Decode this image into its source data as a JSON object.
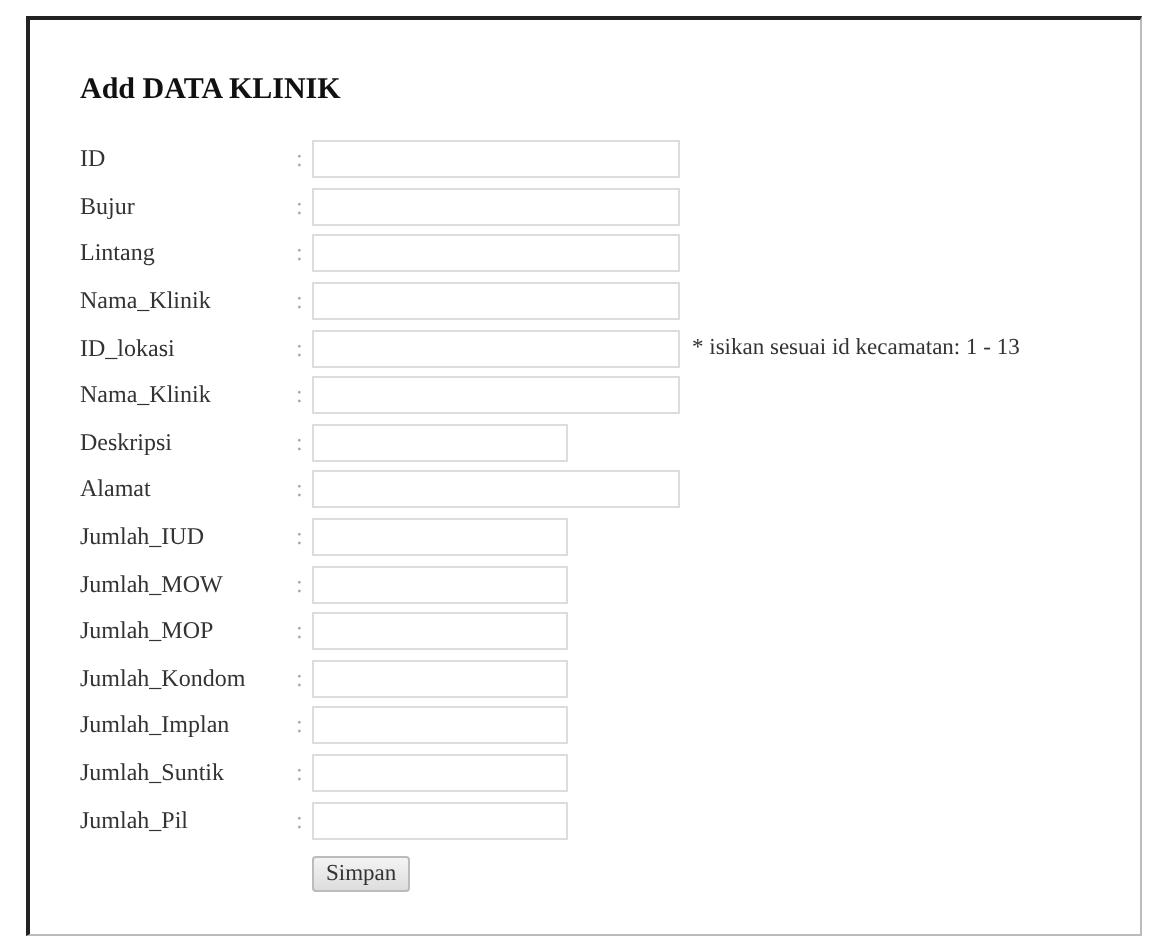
{
  "title": "Add DATA KLINIK",
  "fields": [
    {
      "label": "ID",
      "separator": ":",
      "kind": "long"
    },
    {
      "label": "Bujur",
      "separator": ":",
      "kind": "long"
    },
    {
      "label": "Lintang",
      "separator": ":",
      "kind": "long"
    },
    {
      "label": "Nama_Klinik",
      "separator": ":",
      "kind": "long"
    },
    {
      "label": "ID_lokasi",
      "separator": ":",
      "kind": "long",
      "note": "* isikan sesuai id kecamatan: 1 - 13"
    },
    {
      "label": "Nama_Klinik",
      "separator": ":",
      "kind": "long"
    },
    {
      "label": "Deskripsi",
      "separator": ":",
      "kind": "short"
    },
    {
      "label": "Alamat",
      "separator": ":",
      "kind": "long"
    },
    {
      "label": "Jumlah_IUD",
      "separator": ":",
      "kind": "short"
    },
    {
      "label": "Jumlah_MOW",
      "separator": ":",
      "kind": "short"
    },
    {
      "label": "Jumlah_MOP",
      "separator": ":",
      "kind": "short"
    },
    {
      "label": "Jumlah_Kondom",
      "separator": ":",
      "kind": "short"
    },
    {
      "label": "Jumlah_Implan",
      "separator": ":",
      "kind": "short"
    },
    {
      "label": "Jumlah_Suntik",
      "separator": ":",
      "kind": "short"
    },
    {
      "label": "Jumlah_Pil",
      "separator": ":",
      "kind": "short"
    }
  ],
  "submit": "Simpan"
}
